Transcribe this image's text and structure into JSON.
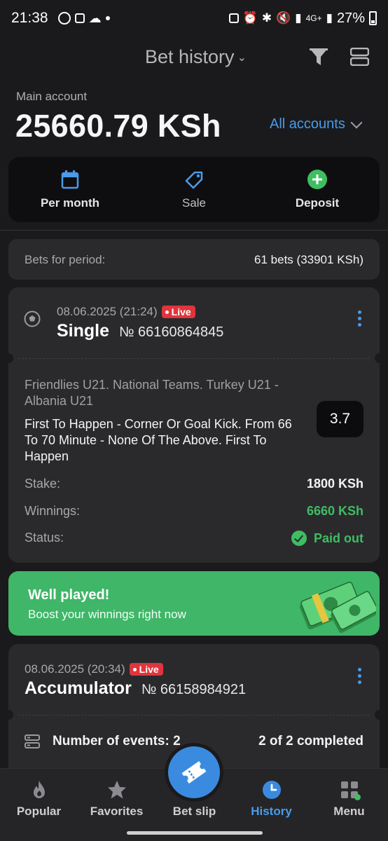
{
  "status_bar": {
    "time": "21:38",
    "battery": "27%",
    "network": "4G+"
  },
  "header": {
    "title": "Bet history"
  },
  "account": {
    "label": "Main account",
    "balance": "25660.79 KSh",
    "selector": "All accounts"
  },
  "actions": [
    {
      "label": "Per month",
      "icon": "calendar-icon"
    },
    {
      "label": "Sale",
      "icon": "tag-icon"
    },
    {
      "label": "Deposit",
      "icon": "plus-circle-icon"
    }
  ],
  "period": {
    "label": "Bets for period:",
    "value": "61 bets (33901 KSh)"
  },
  "bet1": {
    "datetime": "08.06.2025 (21:24)",
    "live": "Live",
    "type": "Single",
    "number": "№ 66160864845",
    "event": "Friendlies U21. National Teams. Turkey U21 - Albania U21",
    "pick": "First To Happen - Corner Or Goal Kick. From 66 To 70 Minute - None Of The Above. First To Happen",
    "odds": "3.7",
    "stake_label": "Stake:",
    "stake": "1800 KSh",
    "winnings_label": "Winnings:",
    "winnings": "6660 KSh",
    "status_label": "Status:",
    "status": "Paid out"
  },
  "promo": {
    "title": "Well played!",
    "subtitle": "Boost your winnings right now"
  },
  "bet2": {
    "datetime": "08.06.2025 (20:34)",
    "live": "Live",
    "type": "Accumulator",
    "number": "№ 66158984921",
    "events_label": "Number of events: 2",
    "events_progress": "2 of 2 completed"
  },
  "nav": [
    {
      "label": "Popular",
      "icon": "flame-icon"
    },
    {
      "label": "Favorites",
      "icon": "star-icon"
    },
    {
      "label": "Bet slip",
      "icon": "ticket-icon"
    },
    {
      "label": "History",
      "icon": "clock-icon",
      "active": true
    },
    {
      "label": "Menu",
      "icon": "grid-icon"
    }
  ],
  "colors": {
    "accent": "#4a9be9",
    "success": "#3fbd63",
    "live": "#e0353d",
    "background": "#1a1a1c",
    "card": "#2a2a2d"
  }
}
